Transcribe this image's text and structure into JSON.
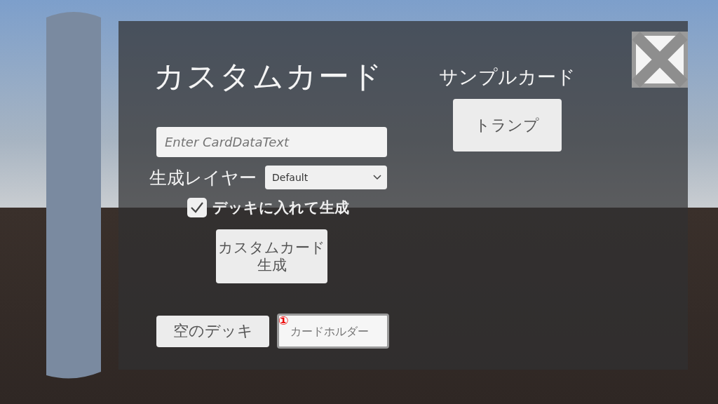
{
  "title": "カスタムカード",
  "card_data_field": {
    "placeholder": "Enter CardDataText"
  },
  "layer": {
    "label": "生成レイヤー",
    "value": "Default"
  },
  "add_to_deck": {
    "label": "デッキに入れて生成",
    "checked": true
  },
  "generate_button": [
    "カスタムカード",
    "生成"
  ],
  "empty_deck_button": "空のデッキ",
  "card_holder_field": {
    "placeholder": "カードホルダー",
    "badge": "①"
  },
  "sample": {
    "title": "サンプルカード",
    "buttons": [
      "トランプ"
    ]
  }
}
